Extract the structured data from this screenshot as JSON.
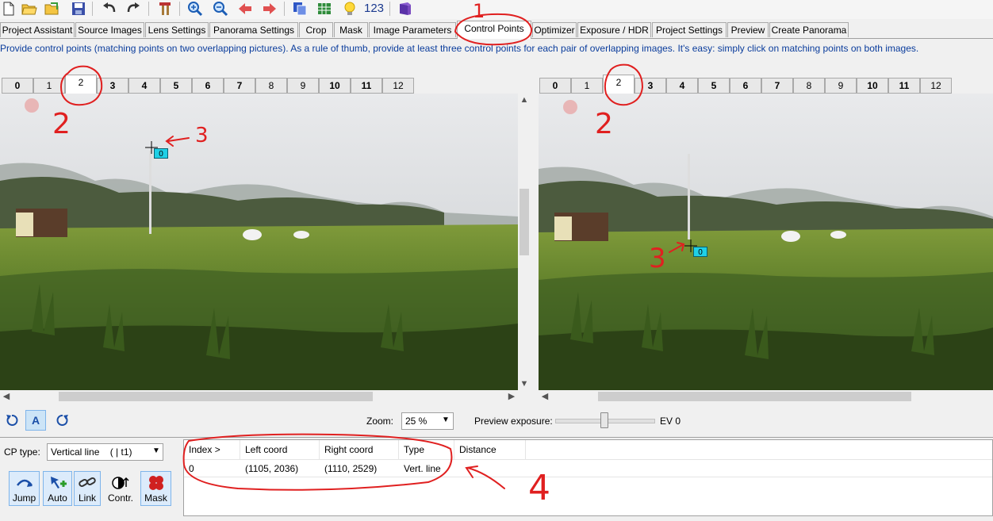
{
  "toolbar": {
    "icons": [
      "new-project-icon",
      "open-icon",
      "open-images-icon",
      "save-icon",
      "undo-icon",
      "redo-icon",
      "tools-icon",
      "zoom-in-icon",
      "zoom-out-icon",
      "previous-icon",
      "next-icon",
      "copy-icon",
      "table-icon",
      "bulb-icon",
      "counter-icon",
      "book-icon"
    ],
    "counter_text": "123"
  },
  "tabs": [
    {
      "label": "Project Assistant"
    },
    {
      "label": "Source Images"
    },
    {
      "label": "Lens Settings"
    },
    {
      "label": "Panorama Settings"
    },
    {
      "label": "Crop"
    },
    {
      "label": "Mask"
    },
    {
      "label": "Image Parameters"
    },
    {
      "label": "Control Points",
      "active": true
    },
    {
      "label": "Optimizer"
    },
    {
      "label": "Exposure / HDR"
    },
    {
      "label": "Project Settings"
    },
    {
      "label": "Preview"
    },
    {
      "label": "Create Panorama"
    }
  ],
  "help_text": "Provide control points (matching points on two overlapping pictures). As a rule of thumb, provide at least three control points for each pair of overlapping images. It's easy: simply click on matching points on both images.",
  "left_image_tabs": [
    "0",
    "1",
    "2",
    "3",
    "4",
    "5",
    "6",
    "7",
    "8",
    "9",
    "10",
    "11",
    "12"
  ],
  "right_image_tabs": [
    "0",
    "1",
    "2",
    "3",
    "4",
    "5",
    "6",
    "7",
    "8",
    "9",
    "10",
    "11",
    "12"
  ],
  "selected_image_left": "2",
  "selected_image_right": "2",
  "control_point_marker_label": "0",
  "controls": {
    "zoom_label": "Zoom:",
    "zoom_value": "25 %",
    "preview_exposure_label": "Preview exposure:",
    "ev_value": "EV 0",
    "exposure_slider_fraction": 0.5,
    "auto_button_label": "A"
  },
  "cp_type": {
    "label": "CP type:",
    "value": "Vertical line    ( | t1)"
  },
  "action_buttons": [
    {
      "label": "Jump"
    },
    {
      "label": "Auto"
    },
    {
      "label": "Link"
    },
    {
      "label": "Contr."
    },
    {
      "label": "Mask"
    }
  ],
  "cp_table": {
    "columns": [
      "Index >",
      "Left coord",
      "Right coord",
      "Type",
      "Distance"
    ],
    "rows": [
      {
        "index": "0",
        "left": "(1105, 2036)",
        "right": "(1110, 2529)",
        "type": "Vert. line",
        "distance": ""
      }
    ]
  },
  "annotations": {
    "tab_marker": "1",
    "image_marker_left": "2",
    "image_marker_right": "2",
    "point_marker_left": "3",
    "point_marker_right": "3",
    "table_marker": "4"
  },
  "colors": {
    "link_blue": "#0a3c9c",
    "cp_marker": "#1fd0e6",
    "annotation_red": "#e02020",
    "selected_button": "#cce4f7"
  }
}
